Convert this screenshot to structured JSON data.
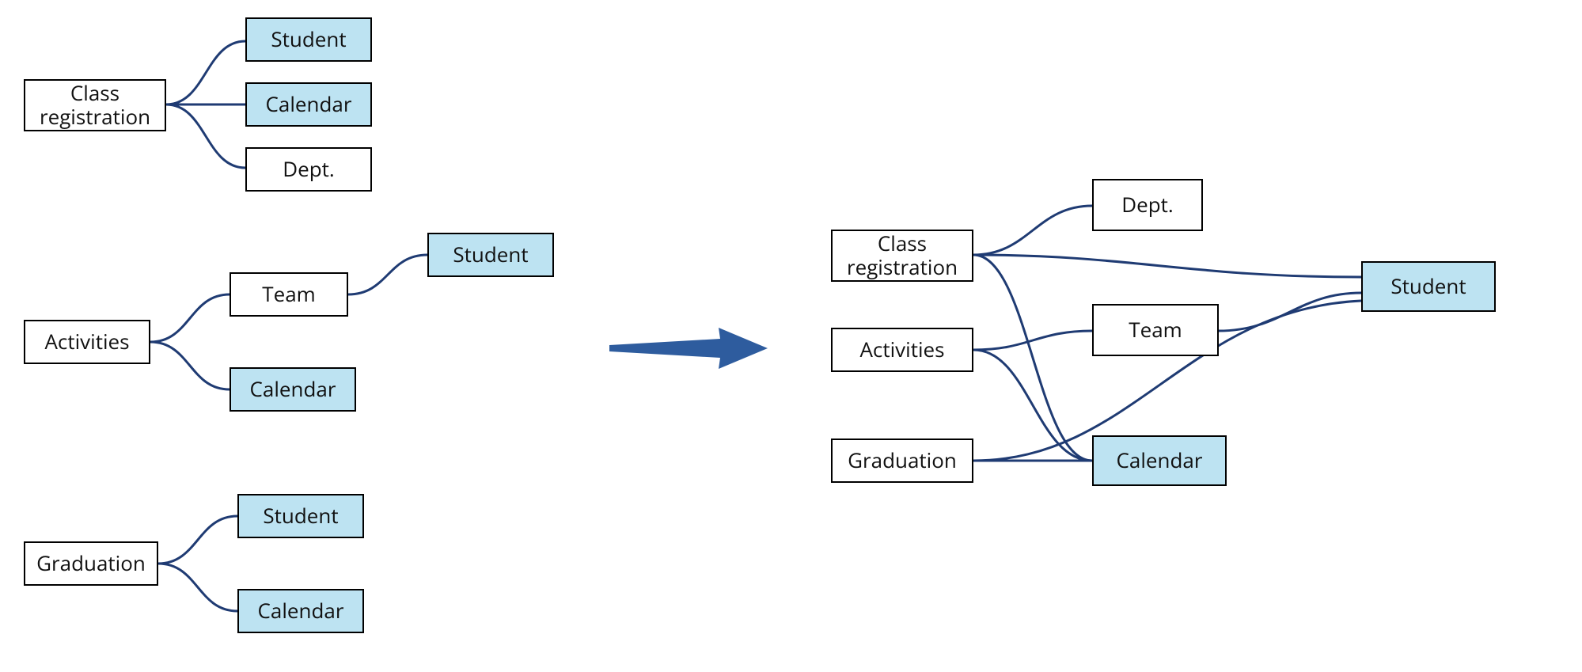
{
  "diagram": {
    "type": "dependency-merge-diagram",
    "description": "Left side shows three separate use-cases each depending on their own copies of shared modules; an arrow points to the right side where the same use-cases share single instances of Student and Calendar.",
    "colors": {
      "shared_fill": "#BDE3F2",
      "border": "#000000",
      "connector": "#1F3B73",
      "arrow": "#2E5C9E"
    },
    "left": {
      "groups": [
        {
          "root": "Class\nregistration",
          "children": [
            {
              "label": "Student",
              "shared": true
            },
            {
              "label": "Calendar",
              "shared": true
            },
            {
              "label": "Dept.",
              "shared": false
            }
          ]
        },
        {
          "root": "Activities",
          "children": [
            {
              "label": "Team",
              "shared": false,
              "children": [
                {
                  "label": "Student",
                  "shared": true
                }
              ]
            },
            {
              "label": "Calendar",
              "shared": true
            }
          ]
        },
        {
          "root": "Graduation",
          "children": [
            {
              "label": "Student",
              "shared": true
            },
            {
              "label": "Calendar",
              "shared": true
            }
          ]
        }
      ]
    },
    "right": {
      "roots": [
        {
          "label": "Class\nregistration"
        },
        {
          "label": "Activities"
        },
        {
          "label": "Graduation"
        }
      ],
      "mids": [
        {
          "label": "Dept.",
          "shared": false
        },
        {
          "label": "Team",
          "shared": false
        },
        {
          "label": "Calendar",
          "shared": true
        }
      ],
      "outer": [
        {
          "label": "Student",
          "shared": true
        }
      ],
      "edges": [
        [
          "Class registration",
          "Dept."
        ],
        [
          "Class registration",
          "Student"
        ],
        [
          "Class registration",
          "Calendar"
        ],
        [
          "Activities",
          "Team"
        ],
        [
          "Activities",
          "Calendar"
        ],
        [
          "Graduation",
          "Student"
        ],
        [
          "Graduation",
          "Calendar"
        ],
        [
          "Team",
          "Student"
        ]
      ]
    }
  },
  "labels": {
    "class_registration": "Class\nregistration",
    "student": "Student",
    "calendar": "Calendar",
    "dept": "Dept.",
    "activities": "Activities",
    "team": "Team",
    "graduation": "Graduation"
  }
}
